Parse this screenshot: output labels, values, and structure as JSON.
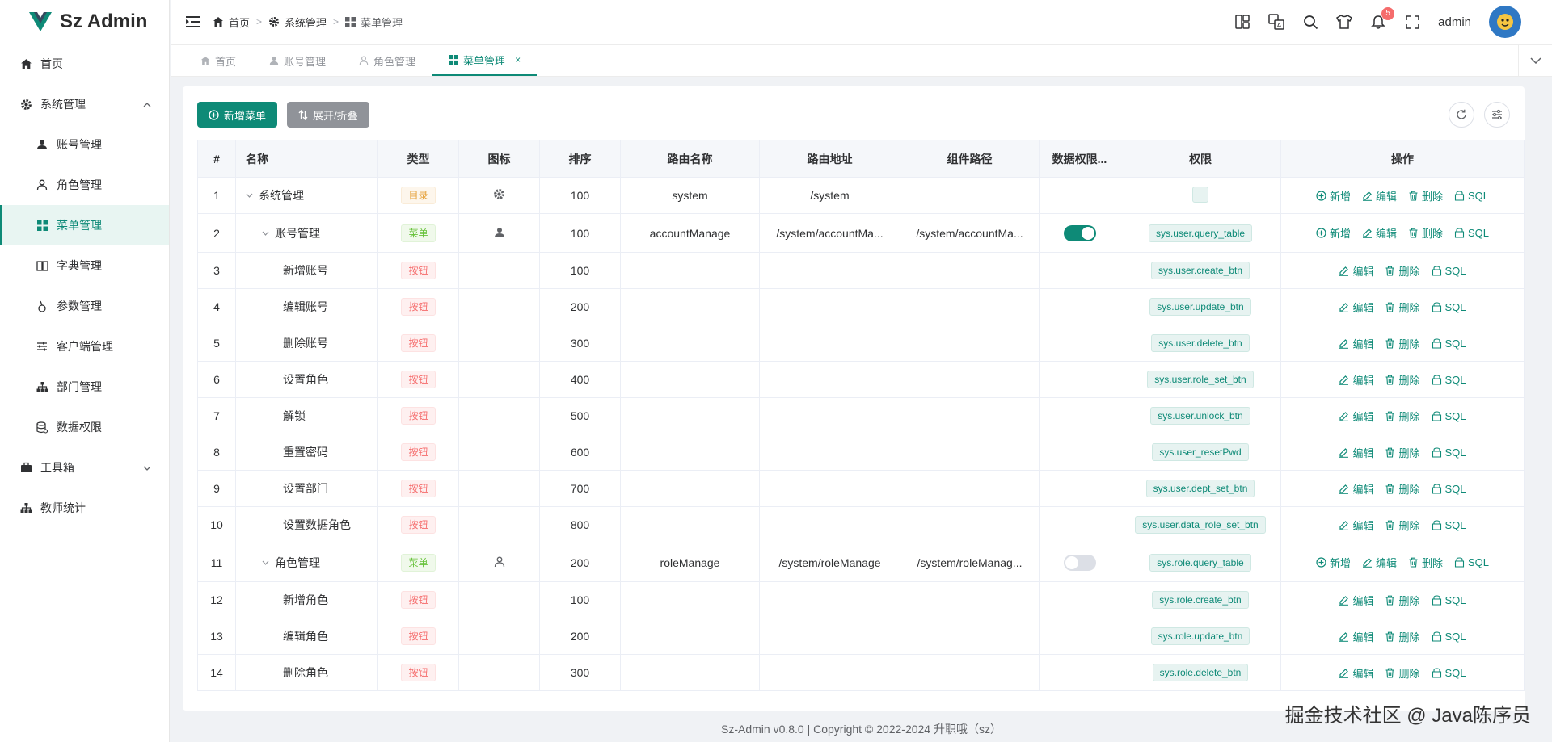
{
  "app": {
    "logo_text": "Sz Admin",
    "brand_color": "#0e8a77"
  },
  "sidebar": {
    "items": [
      {
        "label": "首页",
        "icon": "home-icon"
      },
      {
        "label": "系统管理",
        "icon": "gear-icon",
        "expanded": true
      },
      {
        "label": "账号管理",
        "icon": "user-icon"
      },
      {
        "label": "角色管理",
        "icon": "user-outline-icon"
      },
      {
        "label": "菜单管理",
        "icon": "grid-icon",
        "active": true
      },
      {
        "label": "字典管理",
        "icon": "book-icon"
      },
      {
        "label": "参数管理",
        "icon": "param-icon"
      },
      {
        "label": "客户端管理",
        "icon": "sliders-icon"
      },
      {
        "label": "部门管理",
        "icon": "org-icon"
      },
      {
        "label": "数据权限",
        "icon": "database-icon"
      },
      {
        "label": "工具箱",
        "icon": "toolbox-icon",
        "expanded": false
      },
      {
        "label": "教师统计",
        "icon": "org-icon"
      }
    ]
  },
  "header": {
    "breadcrumb": [
      "首页",
      "系统管理",
      "菜单管理"
    ],
    "notification_count": "5",
    "user_name": "admin"
  },
  "tabs": [
    {
      "label": "首页"
    },
    {
      "label": "账号管理"
    },
    {
      "label": "角色管理"
    },
    {
      "label": "菜单管理",
      "active": true
    }
  ],
  "toolbar": {
    "add_label": "新增菜单",
    "expand_label": "展开/折叠"
  },
  "table": {
    "columns": [
      "#",
      "名称",
      "类型",
      "图标",
      "排序",
      "路由名称",
      "路由地址",
      "组件路径",
      "数据权限...",
      "权限",
      "操作"
    ],
    "op_labels": {
      "add": "新增",
      "edit": "编辑",
      "delete": "删除",
      "sql": "SQL"
    },
    "rows": [
      {
        "idx": "1",
        "name": "系统管理",
        "level": 0,
        "caret": true,
        "type": "目录",
        "type_kind": "dir",
        "icon": "gear-icon",
        "sort": "100",
        "route_name": "system",
        "route_path": "/system",
        "component": "",
        "data_perm": null,
        "perm": "",
        "perm_empty": true,
        "has_add": true
      },
      {
        "idx": "2",
        "name": "账号管理",
        "level": 1,
        "caret": true,
        "type": "菜单",
        "type_kind": "menu",
        "icon": "user-icon",
        "sort": "100",
        "route_name": "accountManage",
        "route_path": "/system/accountMa...",
        "component": "/system/accountMa...",
        "data_perm": true,
        "perm": "sys.user.query_table",
        "has_add": true
      },
      {
        "idx": "3",
        "name": "新增账号",
        "level": 2,
        "type": "按钮",
        "type_kind": "btn",
        "sort": "100",
        "perm": "sys.user.create_btn"
      },
      {
        "idx": "4",
        "name": "编辑账号",
        "level": 2,
        "type": "按钮",
        "type_kind": "btn",
        "sort": "200",
        "perm": "sys.user.update_btn"
      },
      {
        "idx": "5",
        "name": "删除账号",
        "level": 2,
        "type": "按钮",
        "type_kind": "btn",
        "sort": "300",
        "perm": "sys.user.delete_btn"
      },
      {
        "idx": "6",
        "name": "设置角色",
        "level": 2,
        "type": "按钮",
        "type_kind": "btn",
        "sort": "400",
        "perm": "sys.user.role_set_btn"
      },
      {
        "idx": "7",
        "name": "解锁",
        "level": 2,
        "type": "按钮",
        "type_kind": "btn",
        "sort": "500",
        "perm": "sys.user.unlock_btn"
      },
      {
        "idx": "8",
        "name": "重置密码",
        "level": 2,
        "type": "按钮",
        "type_kind": "btn",
        "sort": "600",
        "perm": "sys.user_resetPwd"
      },
      {
        "idx": "9",
        "name": "设置部门",
        "level": 2,
        "type": "按钮",
        "type_kind": "btn",
        "sort": "700",
        "perm": "sys.user.dept_set_btn"
      },
      {
        "idx": "10",
        "name": "设置数据角色",
        "level": 2,
        "type": "按钮",
        "type_kind": "btn",
        "sort": "800",
        "perm": "sys.user.data_role_set_btn"
      },
      {
        "idx": "11",
        "name": "角色管理",
        "level": 1,
        "caret": true,
        "type": "菜单",
        "type_kind": "menu",
        "icon": "user-outline-icon",
        "sort": "200",
        "route_name": "roleManage",
        "route_path": "/system/roleManage",
        "component": "/system/roleManag...",
        "data_perm": false,
        "perm": "sys.role.query_table",
        "has_add": true
      },
      {
        "idx": "12",
        "name": "新增角色",
        "level": 2,
        "type": "按钮",
        "type_kind": "btn",
        "sort": "100",
        "perm": "sys.role.create_btn"
      },
      {
        "idx": "13",
        "name": "编辑角色",
        "level": 2,
        "type": "按钮",
        "type_kind": "btn",
        "sort": "200",
        "perm": "sys.role.update_btn"
      },
      {
        "idx": "14",
        "name": "删除角色",
        "level": 2,
        "type": "按钮",
        "type_kind": "btn",
        "sort": "300",
        "perm": "sys.role.delete_btn"
      }
    ]
  },
  "footer": {
    "text": "Sz-Admin v0.8.0 | Copyright © 2022-2024 升职哦（sz）"
  },
  "watermark": "掘金技术社区 @ Java陈序员"
}
